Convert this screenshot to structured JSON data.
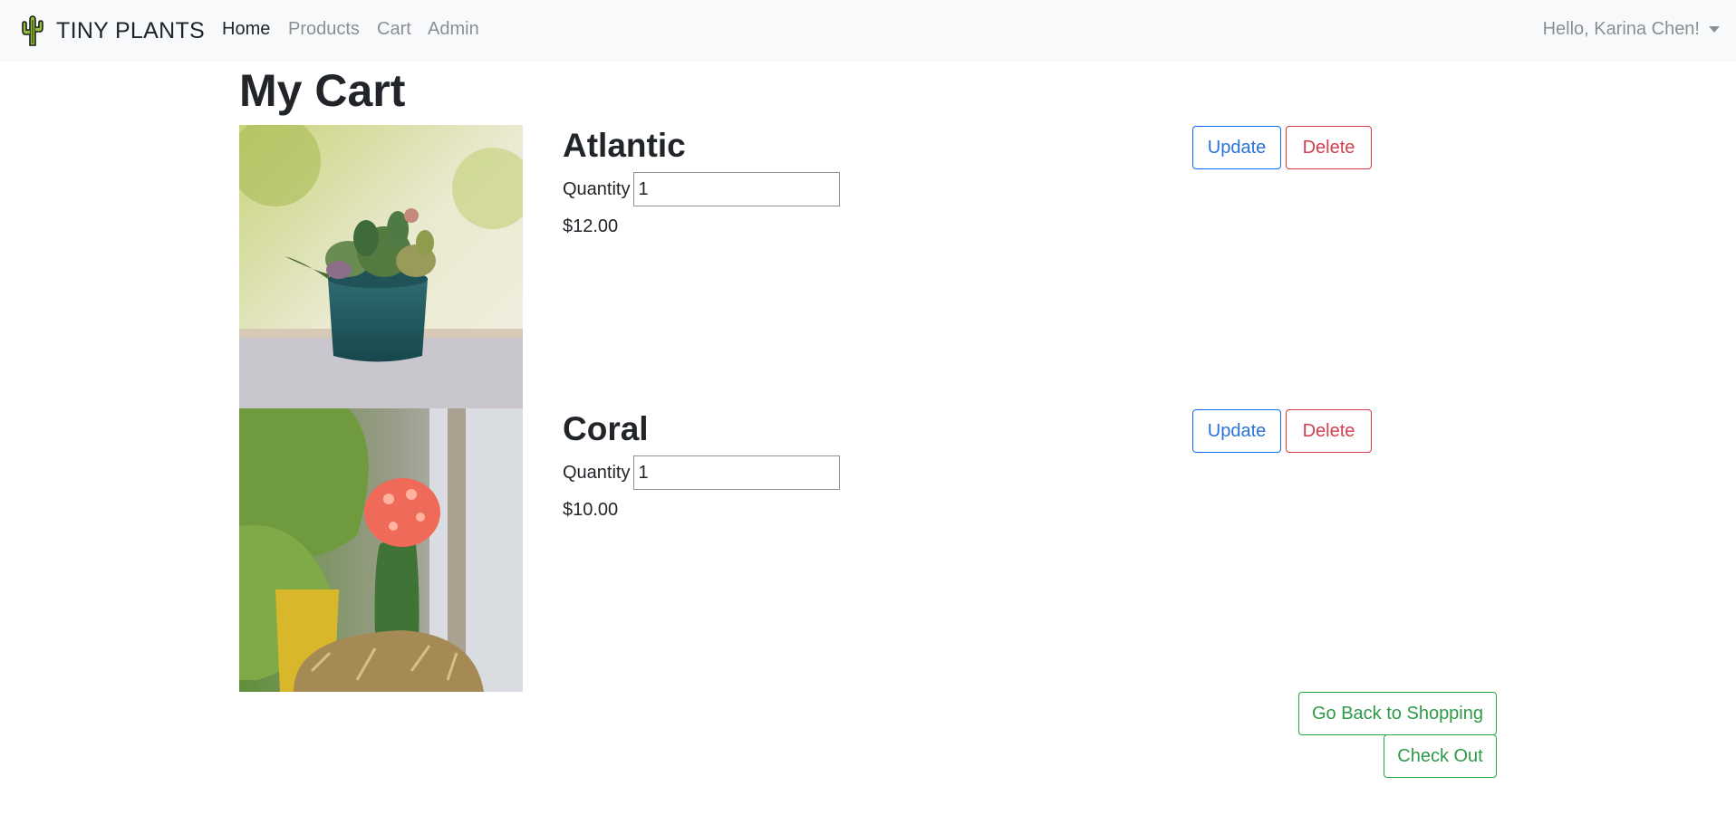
{
  "navbar": {
    "brand": "TINY PLANTS",
    "brand_icon": "cactus-icon",
    "links": [
      {
        "label": "Home",
        "active": true
      },
      {
        "label": "Products",
        "active": false
      },
      {
        "label": "Cart",
        "active": false
      },
      {
        "label": "Admin",
        "active": false
      }
    ],
    "user_greeting": "Hello, Karina Chen!"
  },
  "page": {
    "title": "My Cart"
  },
  "cart": {
    "items": [
      {
        "name": "Atlantic",
        "quantity_label": "Quantity",
        "quantity": "1",
        "price": "$12.00",
        "update_label": "Update",
        "delete_label": "Delete"
      },
      {
        "name": "Coral",
        "quantity_label": "Quantity",
        "quantity": "1",
        "price": "$10.00",
        "update_label": "Update",
        "delete_label": "Delete"
      }
    ]
  },
  "actions": {
    "back_label": "Go Back to Shopping",
    "checkout_label": "Check Out"
  },
  "colors": {
    "navbar_bg": "#f8f9fa",
    "primary": "#0d6efd",
    "danger": "#dc3545",
    "success": "#28a745"
  }
}
